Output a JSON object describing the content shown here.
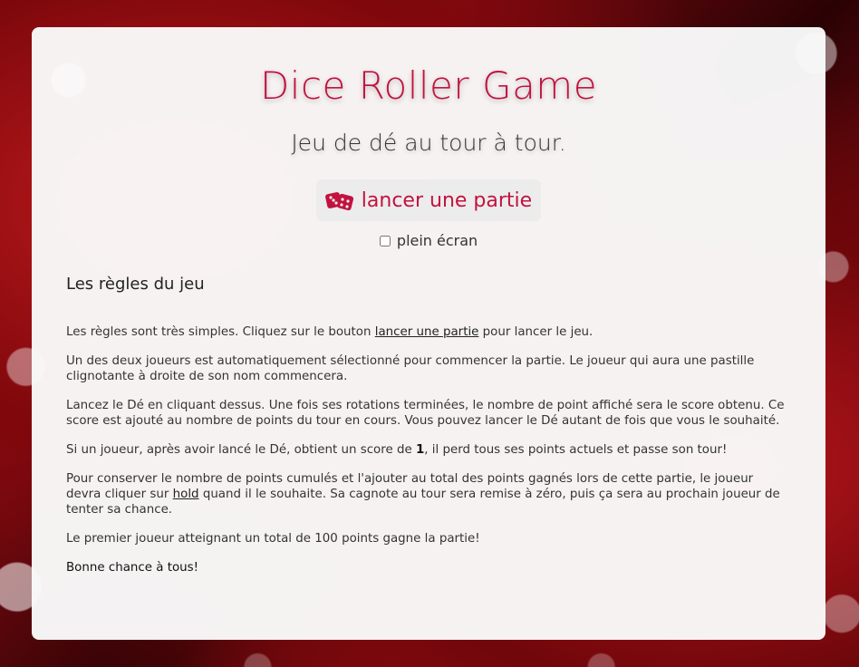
{
  "header": {
    "title": "Dice Roller Game",
    "subtitle": "Jeu de dé au tour à tour."
  },
  "start": {
    "label": "lancer une partie",
    "icon": "dice-icon"
  },
  "fullscreen": {
    "label": "plein écran",
    "checked": false
  },
  "rules": {
    "heading": "Les règles du jeu",
    "p1_before": "Les règles sont très simples. Cliquez sur le bouton ",
    "p1_link": "lancer une partie",
    "p1_after": " pour lancer le jeu.",
    "p2": "Un des deux joueurs est automatiquement sélectionné pour commencer la partie. Le joueur qui aura une pastille clignotante à droite de son nom commencera.",
    "p3": "Lancez le Dé en cliquant dessus. Une fois ses rotations terminées, le nombre de point affiché sera le score obtenu. Ce score est ajouté au nombre de points du tour en cours. Vous pouvez lancer le Dé autant de fois que vous le souhaité.",
    "p4_before": "Si un joueur, après avoir lancé le Dé, obtient un score de ",
    "p4_bold": "1",
    "p4_after": ", il perd tous ses points actuels et passe son tour!",
    "p5_before": "Pour conserver le nombre de points cumulés et l'ajouter au total des points gagnés lors de cette partie, le joueur devra cliquer sur ",
    "p5_link": "hold",
    "p5_after": " quand il le souhaite. Sa cagnote au tour sera remise à zéro, puis ça sera au prochain joueur de tenter sa chance.",
    "p6": "Le premier joueur atteignant un total de 100 points gagne la partie!",
    "p7": "Bonne chance à tous!"
  },
  "colors": {
    "accent": "#c2123f",
    "card": "#fafafa",
    "button_bg": "#ececec"
  }
}
